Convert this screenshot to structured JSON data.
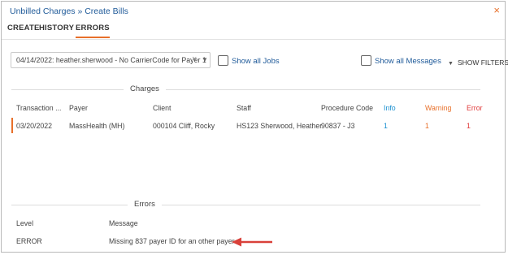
{
  "window": {
    "title": "Unbilled Charges » Create Bills",
    "close_icon": "×"
  },
  "tabs": [
    {
      "label": "CREATE"
    },
    {
      "label": "HISTORY"
    },
    {
      "label": "ERRORS"
    }
  ],
  "toolbar": {
    "job_select_value": "04/14/2022: heather.sherwood - No CarrierCode for Payer 1",
    "show_all_jobs": "Show all Jobs",
    "show_all_messages": "Show all Messages",
    "show_filters": "SHOW FILTERS"
  },
  "charges": {
    "section_label": "Charges",
    "columns": [
      "Transaction ...",
      "Payer",
      "Client",
      "Staff",
      "Procedure Code",
      "Info",
      "Warning",
      "Error"
    ],
    "rows": [
      {
        "transaction": "03/20/2022",
        "payer": "MassHealth (MH)",
        "client": "000104 Cliff, Rocky",
        "staff": "HS123 Sherwood, Heather",
        "procedure_code": "90837 - J3",
        "info": "1",
        "warning": "1",
        "error": "1"
      }
    ]
  },
  "errors": {
    "section_label": "Errors",
    "columns": [
      "Level",
      "Message"
    ],
    "rows": [
      {
        "level": "ERROR",
        "message": "Missing 837 payer ID for an other payer"
      }
    ]
  },
  "colors": {
    "accent": "#e8702a",
    "link": "#1f5a99",
    "info": "#1a8fd0",
    "error": "#e03a3a",
    "annotation_arrow": "#d9413a"
  }
}
